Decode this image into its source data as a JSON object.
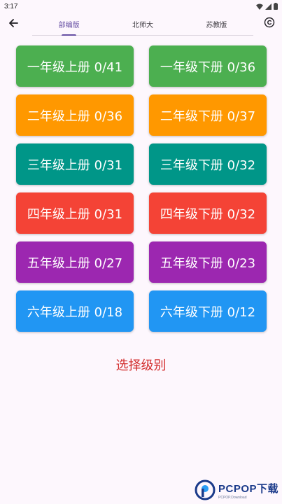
{
  "status": {
    "time": "3:17"
  },
  "tabs": [
    {
      "label": "部编版",
      "active": true
    },
    {
      "label": "北师大",
      "active": false
    },
    {
      "label": "苏教版",
      "active": false
    }
  ],
  "icons": {
    "back": "arrow-left-icon",
    "copyright": "copyright-icon"
  },
  "grades": [
    {
      "label": "一年级上册 0/41",
      "color": "#4caf50"
    },
    {
      "label": "一年级下册 0/36",
      "color": "#4caf50"
    },
    {
      "label": "二年级上册 0/36",
      "color": "#ff9800"
    },
    {
      "label": "二年级下册 0/37",
      "color": "#ff9800"
    },
    {
      "label": "三年级上册 0/31",
      "color": "#009688"
    },
    {
      "label": "三年级下册 0/32",
      "color": "#009688"
    },
    {
      "label": "四年级上册 0/31",
      "color": "#f44336"
    },
    {
      "label": "四年级下册 0/32",
      "color": "#f44336"
    },
    {
      "label": "五年级上册 0/27",
      "color": "#9c27b0"
    },
    {
      "label": "五年级下册 0/23",
      "color": "#9c27b0"
    },
    {
      "label": "六年级上册 0/18",
      "color": "#2196f3"
    },
    {
      "label": "六年级下册 0/12",
      "color": "#2196f3"
    }
  ],
  "select_level": "选择级别",
  "watermark": {
    "main": "PCPOP下载",
    "sub": "PCPOP.Download"
  }
}
